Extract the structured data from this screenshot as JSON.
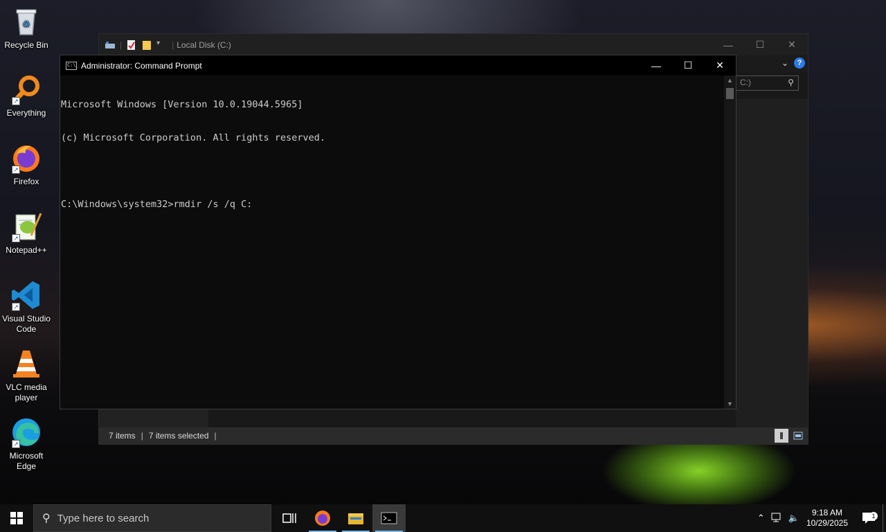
{
  "desktop": {
    "icons": [
      {
        "label": "Recycle Bin",
        "icon": "recycle-bin-icon"
      },
      {
        "label": "Everything",
        "icon": "everything-search-icon"
      },
      {
        "label": "Firefox",
        "icon": "firefox-icon"
      },
      {
        "label": "Notepad++",
        "icon": "notepadpp-icon"
      },
      {
        "label": "Visual Studio Code",
        "icon": "vscode-icon"
      },
      {
        "label": "VLC media player",
        "icon": "vlc-icon"
      },
      {
        "label": "Microsoft Edge",
        "icon": "edge-icon"
      }
    ]
  },
  "explorer": {
    "title": "Local Disk (C:)",
    "search_placeholder": "C:)",
    "status": {
      "items": "7 items",
      "selected": "7 items selected",
      "sep": "|"
    }
  },
  "cmd": {
    "title": "Administrator: Command Prompt",
    "lines": [
      "Microsoft Windows [Version 10.0.19044.5965]",
      "(c) Microsoft Corporation. All rights reserved.",
      "",
      "C:\\Windows\\system32>rmdir /s /q C:"
    ]
  },
  "taskbar": {
    "search_placeholder": "Type here to search",
    "time": "9:18 AM",
    "date": "10/29/2025",
    "notification_count": "1",
    "accent": "#76b9ed"
  }
}
